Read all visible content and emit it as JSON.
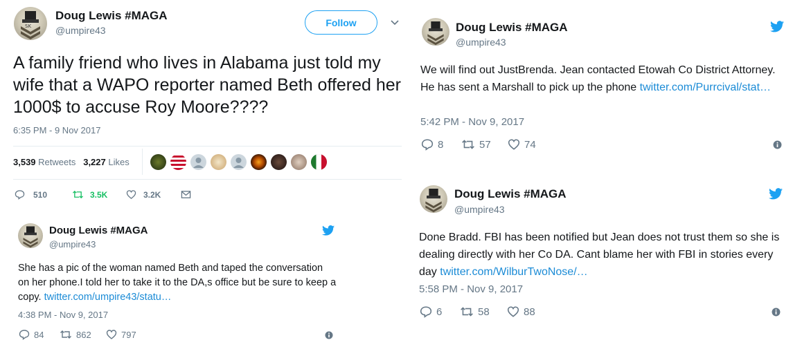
{
  "colors": {
    "accent": "#1da1f2",
    "link": "#1b8bd6",
    "muted": "#657786",
    "retweet_active": "#17bf63"
  },
  "main_tweet": {
    "name": "Doug Lewis #MAGA",
    "handle": "@umpire43",
    "follow_label": "Follow",
    "text": "A family friend who lives in Alabama  just told my wife that a WAPO reporter named Beth offered her 1000$ to accuse Roy Moore????",
    "timestamp": "6:35 PM - 9 Nov 2017",
    "retweets_count": "3,539",
    "retweets_label": "Retweets",
    "likes_count": "3,227",
    "likes_label": "Likes",
    "actions": {
      "reply": "510",
      "retweet": "3.5K",
      "like": "3.2K"
    }
  },
  "reply_tweet_1": {
    "name": "Doug Lewis #MAGA",
    "handle": "@umpire43",
    "text": "She has a pic of the woman named Beth and taped the conversation on her phone.I told her to take it to the DA,s office but be sure to keep a copy. ",
    "link": "twitter.com/umpire43/statu…",
    "timestamp": "4:38 PM - Nov 9, 2017",
    "actions": {
      "reply": "84",
      "retweet": "862",
      "like": "797"
    }
  },
  "reply_tweet_2": {
    "name": "Doug Lewis #MAGA",
    "handle": "@umpire43",
    "text": "We will find out JustBrenda. Jean contacted Etowah Co District Attorney. He has sent a Marshall to pick up the phone ",
    "link": "twitter.com/Purrcival/stat…",
    "timestamp": "5:42 PM - Nov 9, 2017",
    "actions": {
      "reply": "8",
      "retweet": "57",
      "like": "74"
    }
  },
  "reply_tweet_3": {
    "name": "Doug Lewis #MAGA",
    "handle": "@umpire43",
    "text": "Done Bradd. FBI has been notified but Jean does not trust them so she is dealing directly with her Co DA. Cant blame her with FBI in stories every day ",
    "link": "twitter.com/WilburTwoNose/…",
    "timestamp": "5:58 PM - Nov 9, 2017",
    "actions": {
      "reply": "6",
      "retweet": "58",
      "like": "88"
    }
  }
}
